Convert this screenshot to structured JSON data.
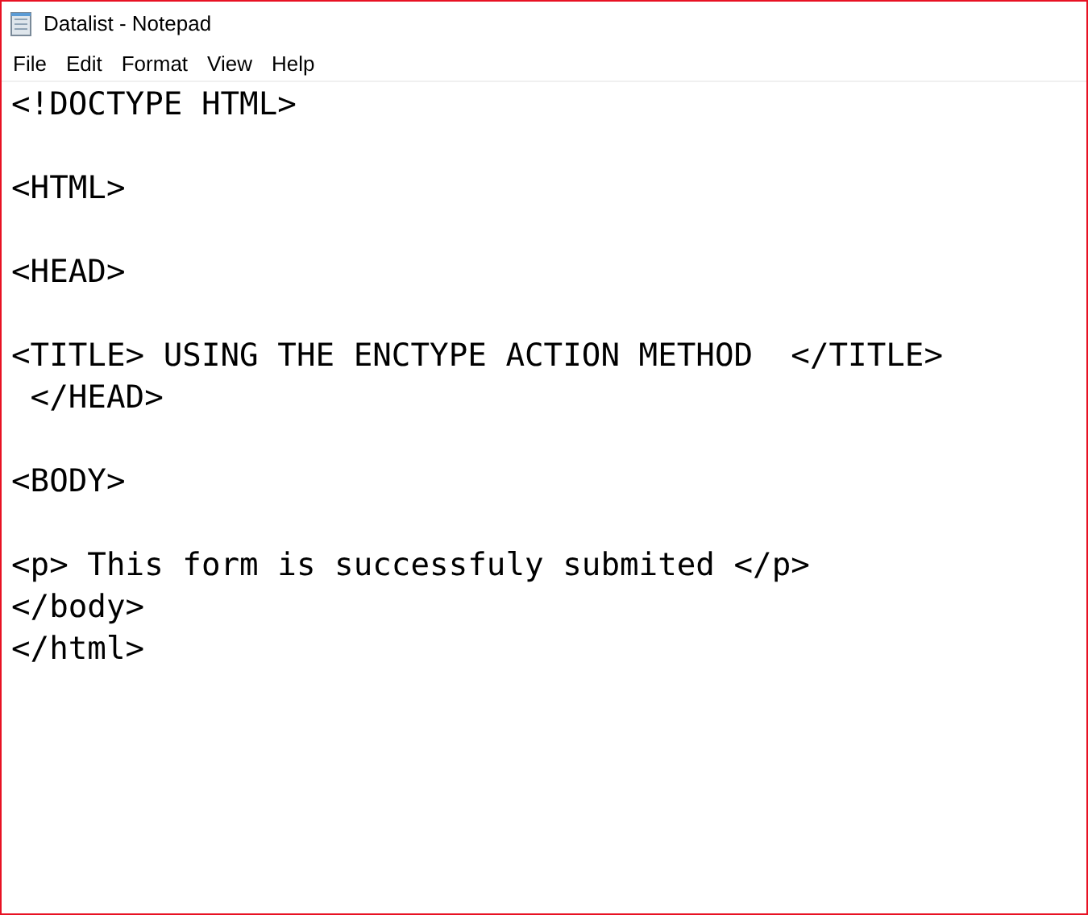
{
  "window": {
    "title": "Datalist - Notepad"
  },
  "menu": [
    "File",
    "Edit",
    "Format",
    "View",
    "Help"
  ],
  "editor": {
    "content": "<!DOCTYPE HTML>\n\n<HTML>\n\n<HEAD>\n\n<TITLE> USING THE ENCTYPE ACTION METHOD  </TITLE>\n </HEAD>\n\n<BODY>\n\n<p> This form is successfuly submited </p>\n</body>\n</html>"
  }
}
